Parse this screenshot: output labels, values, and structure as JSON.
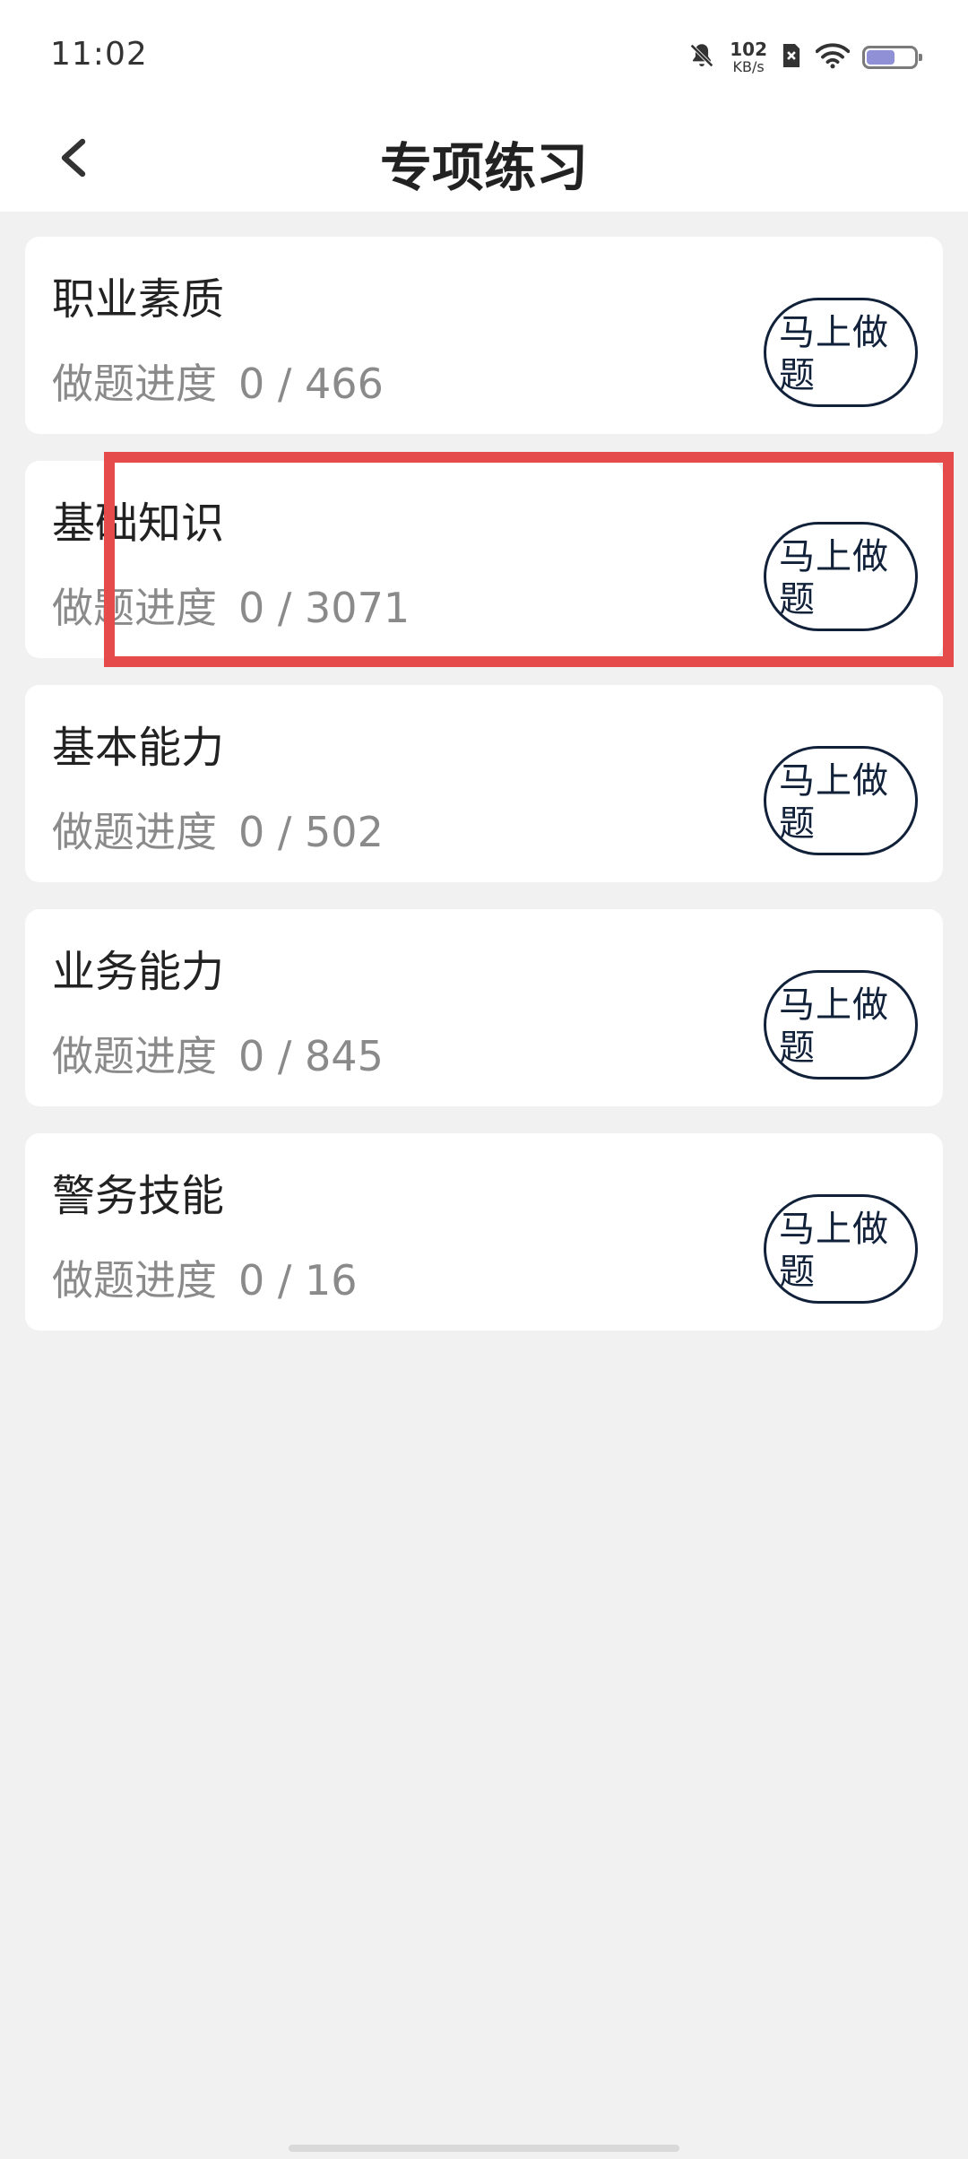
{
  "status_bar": {
    "time": "11:02",
    "net_speed_value": "102",
    "net_speed_unit": "KB/s",
    "battery_level": 0.6,
    "icons": [
      "bell-muted-icon",
      "sim-disabled-icon",
      "wifi-icon",
      "battery-icon"
    ]
  },
  "header": {
    "title": "专项练习",
    "back_icon": "chevron-left-icon"
  },
  "progress_label": "做题进度",
  "items": [
    {
      "title": "职业素质",
      "done": "0",
      "total": "466",
      "button": "马上做题"
    },
    {
      "title": "基础知识",
      "done": "0",
      "total": "3071",
      "button": "马上做题"
    },
    {
      "title": "基本能力",
      "done": "0",
      "total": "502",
      "button": "马上做题"
    },
    {
      "title": "业务能力",
      "done": "0",
      "total": "845",
      "button": "马上做题"
    },
    {
      "title": "警务技能",
      "done": "0",
      "total": "16",
      "button": "马上做题"
    }
  ],
  "colors": {
    "page_bg": "#f1f1f1",
    "card_bg": "#ffffff",
    "button_border": "#11213a",
    "highlight": "#e64b4b"
  }
}
